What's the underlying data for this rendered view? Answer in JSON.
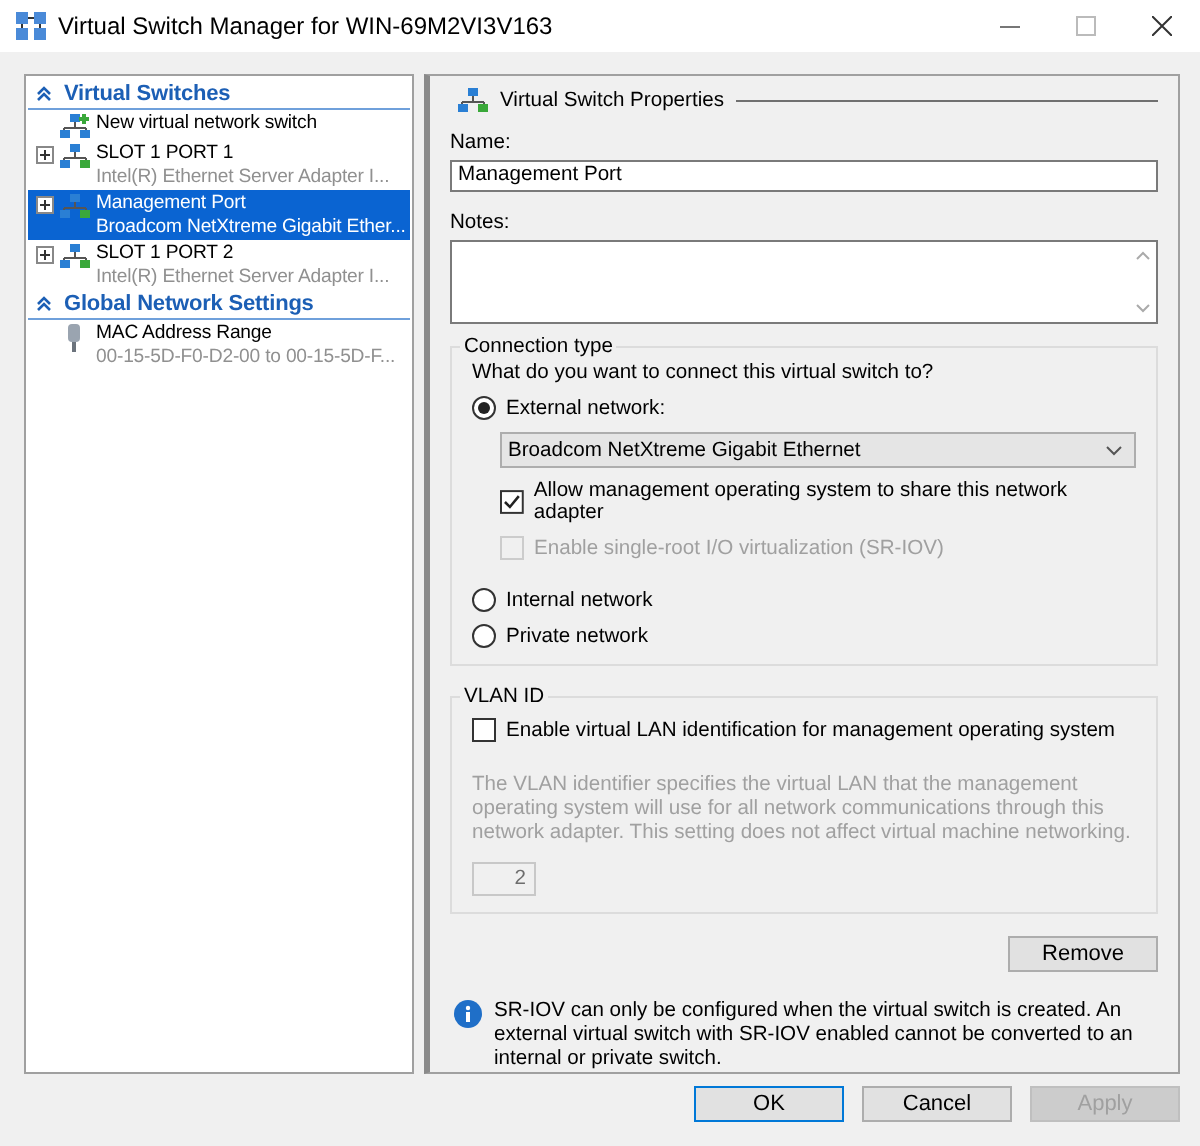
{
  "window": {
    "title": "Virtual Switch Manager for WIN-69M2VI3V163"
  },
  "sidebar": {
    "sections": [
      {
        "title": "Virtual Switches",
        "expanded": true,
        "items": [
          {
            "kind": "new",
            "label": "New virtual network switch",
            "selected": false
          },
          {
            "kind": "switch",
            "label": "SLOT 1 PORT 1",
            "sublabel": "Intel(R) Ethernet Server Adapter I...",
            "expanded": false,
            "selected": false
          },
          {
            "kind": "switch",
            "label": "Management Port",
            "sublabel": "Broadcom NetXtreme Gigabit Ether...",
            "expanded": false,
            "selected": true
          },
          {
            "kind": "switch",
            "label": "SLOT 1 PORT 2",
            "sublabel": "Intel(R) Ethernet Server Adapter I...",
            "expanded": false,
            "selected": false
          }
        ]
      },
      {
        "title": "Global Network Settings",
        "expanded": true,
        "items": [
          {
            "kind": "mac",
            "label": "MAC Address Range",
            "sublabel": "00-15-5D-F0-D2-00 to 00-15-5D-F...",
            "selected": false
          }
        ]
      }
    ]
  },
  "properties": {
    "title": "Virtual Switch Properties",
    "name_label": "Name:",
    "name_value": "Management Port",
    "notes_label": "Notes:",
    "connection": {
      "title": "Connection type",
      "question": "What do you want to connect this virtual switch to?",
      "options": [
        {
          "label": "External network:",
          "selected": true
        },
        {
          "label": "Internal network",
          "selected": false
        },
        {
          "label": "Private network",
          "selected": false
        }
      ],
      "adapter": "Broadcom NetXtreme Gigabit Ethernet",
      "checkboxes": [
        {
          "label": "Allow management operating system to share this network adapter",
          "checked": true,
          "disabled": false
        },
        {
          "label": "Enable single-root I/O virtualization (SR-IOV)",
          "checked": false,
          "disabled": true
        }
      ]
    },
    "vlan": {
      "title": "VLAN ID",
      "checkbox": {
        "label": "Enable virtual LAN identification for management operating system",
        "checked": false
      },
      "description": "The VLAN identifier specifies the virtual LAN that the management operating system will use for all network communications through this network adapter. This setting does not affect virtual machine networking.",
      "value": "2"
    },
    "remove": "Remove",
    "info": "SR-IOV can only be configured when the virtual switch is created. An external virtual switch with SR-IOV enabled cannot be converted to an internal or private switch."
  },
  "buttons": [
    {
      "label": "OK",
      "default": true,
      "disabled": false
    },
    {
      "label": "Cancel",
      "default": false,
      "disabled": false
    },
    {
      "label": "Apply",
      "default": false,
      "disabled": true
    }
  ]
}
